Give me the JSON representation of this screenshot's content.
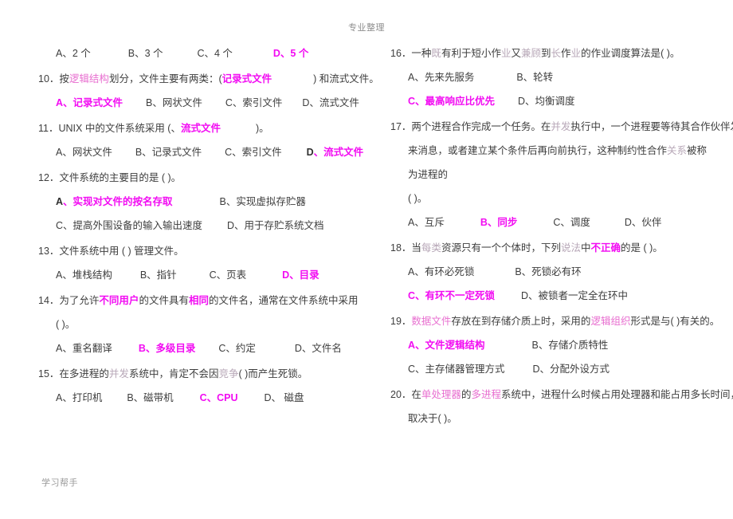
{
  "page": {
    "running_head": "专业整理",
    "running_foot": "学习帮手",
    "accent_answer": "#f20cf2",
    "accent_keyword": "#e86fd0",
    "text_color": "#3d3d3d"
  },
  "left_column": {
    "q09_options": {
      "a": "A、2 个",
      "b": "B、3 个",
      "c": "C、4 个",
      "d": "D、5 个"
    },
    "q10": {
      "num": "10．",
      "stem_1": "按",
      "stem_kw1": "逻辑结构",
      "stem_2": "划分，文件主要有两类：(",
      "stem_ans": "记录式文件",
      "stem_3": ") 和流式文件。",
      "options": {
        "a": "A、记录式文件",
        "b": "B、网状文件",
        "c": "C、索引文件",
        "d": "D、流式文件"
      }
    },
    "q11": {
      "num": "11．",
      "stem_1": "UNIX 中的文件系统采用 (、",
      "stem_ans": "流式文件",
      "stem_2": ")。",
      "options": {
        "a": "A、网状文件",
        "b": "B、记录式文件",
        "c": "C、索引文件",
        "d_letter": "D",
        "d_rest": "、流式文件"
      }
    },
    "q12": {
      "num": "12．",
      "stem": "文件系统的主要目的是 (        )。",
      "options": {
        "a_letter": "A",
        "a_rest": "、实现对文件的按名存取",
        "b": "B、实现虚拟存贮器",
        "c": "C、提高外围设备的输入输出速度",
        "d": "D、用于存贮系统文档"
      }
    },
    "q13": {
      "num": "13．",
      "stem": "文件系统中用 (        ) 管理文件。",
      "options": {
        "a": "A、堆栈结构",
        "b": "B、指针",
        "c": "C、页表",
        "d": "D、目录"
      }
    },
    "q14": {
      "num": "14．",
      "stem_1": "为了允许",
      "stem_kw1": "不同用户",
      "stem_2": "的文件具有",
      "stem_kw2": "相同",
      "stem_3": "的文件名，通常在文件系统中采用",
      "stem_cont": "(        )。",
      "options": {
        "a": "A、重名翻译",
        "b": "B、多级目录",
        "c": "C、约定",
        "d": "D、文件名"
      }
    },
    "q15": {
      "num": "15．",
      "stem_1": "在多进程的",
      "stem_kw1": "并发",
      "stem_2": "系统中，肯定不会因",
      "stem_kw2": "竞争",
      "stem_3": "(        )而产生死锁。",
      "options": {
        "a": "A、打印机",
        "b": "B、磁带机",
        "c": "C、CPU",
        "d": "D、 磁盘"
      }
    }
  },
  "right_column": {
    "q16": {
      "num": "16．",
      "stem_1": "一种",
      "stem_kw1": "既",
      "stem_2": "有利于短小作",
      "stem_kw2": "业",
      "stem_3": "又",
      "stem_kw3": "兼顾",
      "stem_4": "到",
      "stem_kw4": "长",
      "stem_5": "作",
      "stem_kw5": "业",
      "stem_6": "的作业调度算法是(        )。",
      "options": {
        "a": "A、先来先服务",
        "b": "B、轮转",
        "c": "C、最高响应比优先",
        "d": "D、均衡调度"
      }
    },
    "q17": {
      "num": "17．",
      "line1_a": "两个进程合作完成一个任务。在",
      "line1_kw": "并发",
      "line1_b": "执行中，一个进程要等待其合作伙伴发",
      "line2_a": "来消息，或者建立某个条件后再向前执行，这种制约性合作",
      "line2_kw": "关系",
      "line2_b": "被称为进程的",
      "line3": "(        )。",
      "options": {
        "a": "A、互斥",
        "b": "B、同步",
        "c": "C、调度",
        "d": "D、伙伴"
      }
    },
    "q18": {
      "num": "18．",
      "stem_1": "当",
      "stem_kw1": "每类",
      "stem_2": "资源只有一个个体时，下列",
      "stem_kw2": "说法",
      "stem_3": "中",
      "stem_ans": "不正确",
      "stem_4": "的是 (        )。",
      "options": {
        "a": "A、有环必死锁",
        "b": "B、死锁必有环",
        "c": "C、有环不一定死锁",
        "d": "D、被锁者一定全在环中"
      }
    },
    "q19": {
      "num": "19．",
      "stem_kw1": "数据文件",
      "stem_1": "存放在到存储介质上时，采用的",
      "stem_kw2": "逻辑组织",
      "stem_2": "形式是与(        )有关的。",
      "options": {
        "a": "A、文件逻辑结构",
        "b": "B、存储介质特性",
        "c": "C、主存储器管理方式",
        "d": "D、分配外设方式"
      }
    },
    "q20": {
      "num": "20．",
      "stem_1": "在",
      "stem_kw1": "单处理器",
      "stem_2": "的",
      "stem_kw2": "多进程",
      "stem_3": "系统中，进程什么时候占用处理器和能占用多长时间，",
      "stem_cont": "取决于(        )。"
    }
  }
}
